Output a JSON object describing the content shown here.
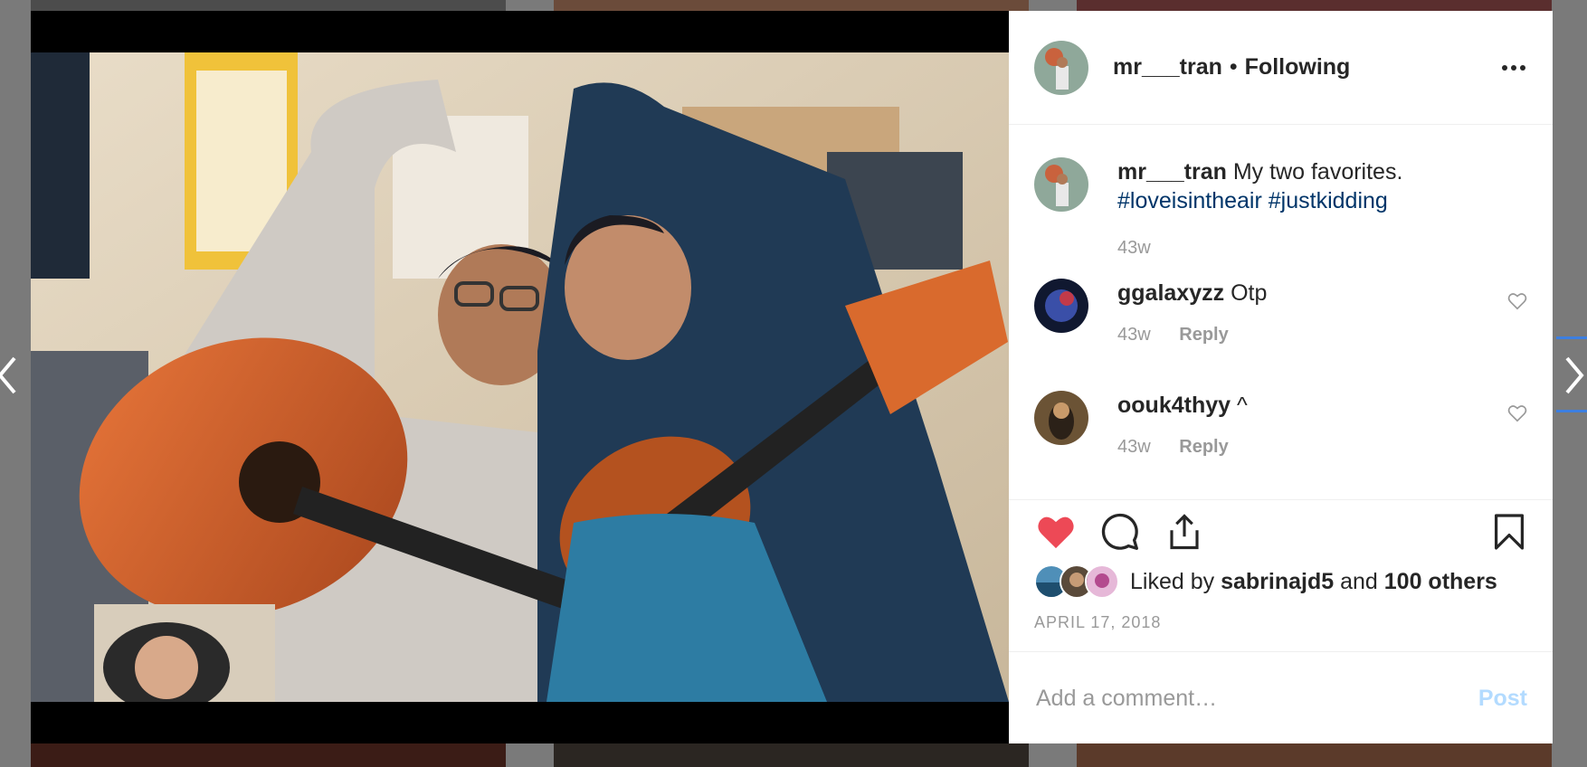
{
  "post": {
    "username": "mr___tran",
    "follow_state": "Following",
    "separator": "•",
    "caption_text": "My two favorites.",
    "hashtags": [
      "#loveisintheair",
      "#justkidding"
    ],
    "caption_age": "43w",
    "date": "APRIL 17, 2018"
  },
  "comments": [
    {
      "user": "ggalaxyzz",
      "text": "Otp",
      "age": "43w",
      "reply_label": "Reply"
    },
    {
      "user": "oouk4thyy",
      "text": "^",
      "age": "43w",
      "reply_label": "Reply"
    }
  ],
  "likes": {
    "prefix": "Liked by",
    "top_liker": "sabrinajd5",
    "joiner": "and",
    "others": "100 others"
  },
  "composer": {
    "placeholder": "Add a comment…",
    "post_label": "Post"
  },
  "icons": {
    "like": "heart-filled-icon",
    "comment": "speech-bubble-icon",
    "share": "share-icon",
    "save": "bookmark-icon",
    "more": "ellipsis-icon"
  },
  "colors": {
    "like_red": "#ed4956",
    "link_blue": "#003569",
    "post_disabled": "#b3dbff",
    "meta_gray": "#999999"
  }
}
